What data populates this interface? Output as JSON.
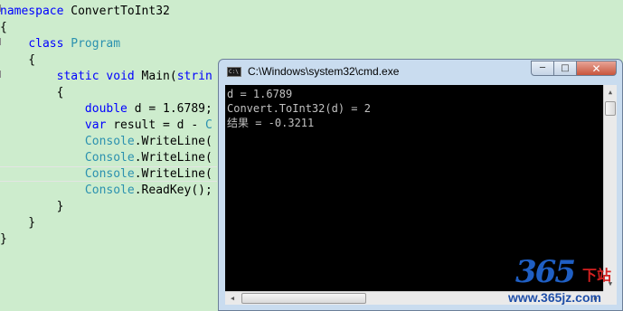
{
  "editor": {
    "lines": [
      "namespace ConvertToInt32",
      "{",
      "    class Program",
      "    {",
      "        static void Main(strin",
      "        {",
      "            double d = 1.6789;",
      "            var result = d - C",
      "            Console.WriteLine(",
      "            Console.WriteLine(",
      "            Console.WriteLine(",
      "            Console.ReadKey();",
      "        }",
      "    }",
      "}"
    ]
  },
  "cmd": {
    "title": "C:\\Windows\\system32\\cmd.exe",
    "icon": "cmd-icon",
    "icon_text": "C:\\",
    "buttons": {
      "minimize": "─",
      "maximize": "□",
      "close": "✕"
    },
    "output": [
      "d = 1.6789",
      "Convert.ToInt32(d) = 2",
      "结果 = -0.3211"
    ],
    "scroll_arrows": {
      "up": "▲",
      "down": "▼",
      "left": "◀",
      "right": "▶"
    }
  },
  "watermark": {
    "number": "365",
    "cn": "下站",
    "url": "www.365jz.com"
  },
  "colors": {
    "editor_bg": "#cdeccd",
    "keyword": "#0000ff",
    "type": "#2b91af",
    "console_bg": "#000000",
    "console_text": "#c0c0c0"
  }
}
